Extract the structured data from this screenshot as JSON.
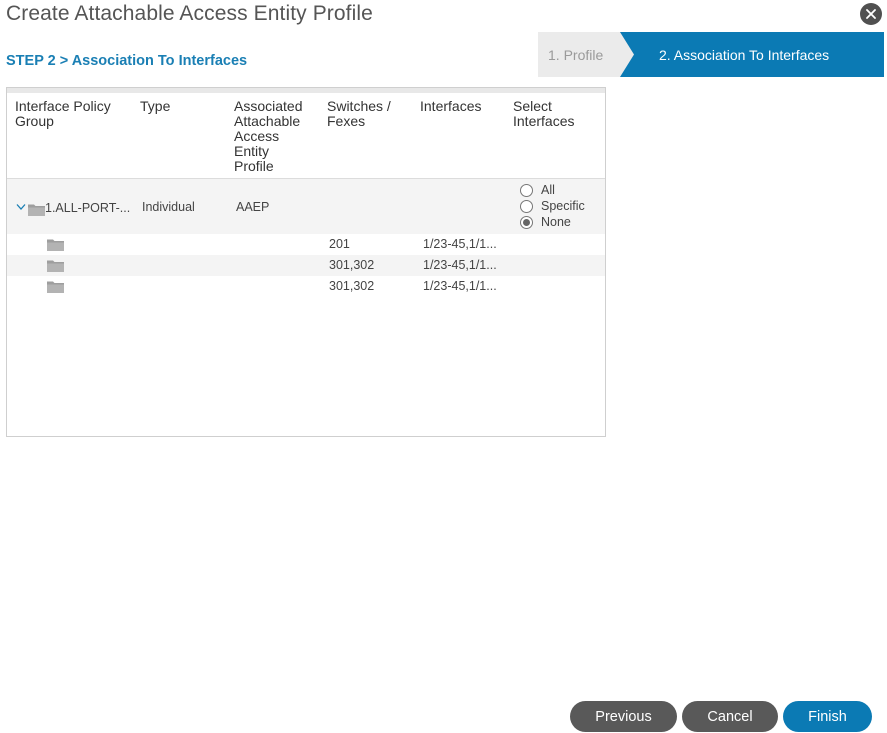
{
  "dialog": {
    "title": "Create Attachable Access Entity Profile",
    "step_label": "STEP 2 > Association To Interfaces"
  },
  "wizard": {
    "steps": [
      {
        "label": "1. Profile",
        "active": false
      },
      {
        "label": "2. Association To Interfaces",
        "active": true
      }
    ]
  },
  "table": {
    "columns": [
      [
        "Interface Policy",
        "Group"
      ],
      [
        "Type"
      ],
      [
        "Associated",
        "Attachable",
        "Access",
        "Entity",
        "Profile"
      ],
      [
        "Switches /",
        "Fexes"
      ],
      [
        "Interfaces"
      ],
      [
        "Select",
        "Interfaces"
      ]
    ],
    "parent_row": {
      "name": "1.ALL-PORT-...",
      "type": "Individual",
      "aaep": "AAEP",
      "select_options": [
        "All",
        "Specific",
        "None"
      ],
      "selected": "None"
    },
    "child_rows": [
      {
        "switches": "201",
        "interfaces": "1/23-45,1/1..."
      },
      {
        "switches": "301,302",
        "interfaces": "1/23-45,1/1..."
      },
      {
        "switches": "301,302",
        "interfaces": "1/23-45,1/1..."
      }
    ]
  },
  "buttons": {
    "previous": "Previous",
    "cancel": "Cancel",
    "finish": "Finish"
  },
  "colors": {
    "accent": "#0b7ab4",
    "button_gray": "#595959"
  }
}
